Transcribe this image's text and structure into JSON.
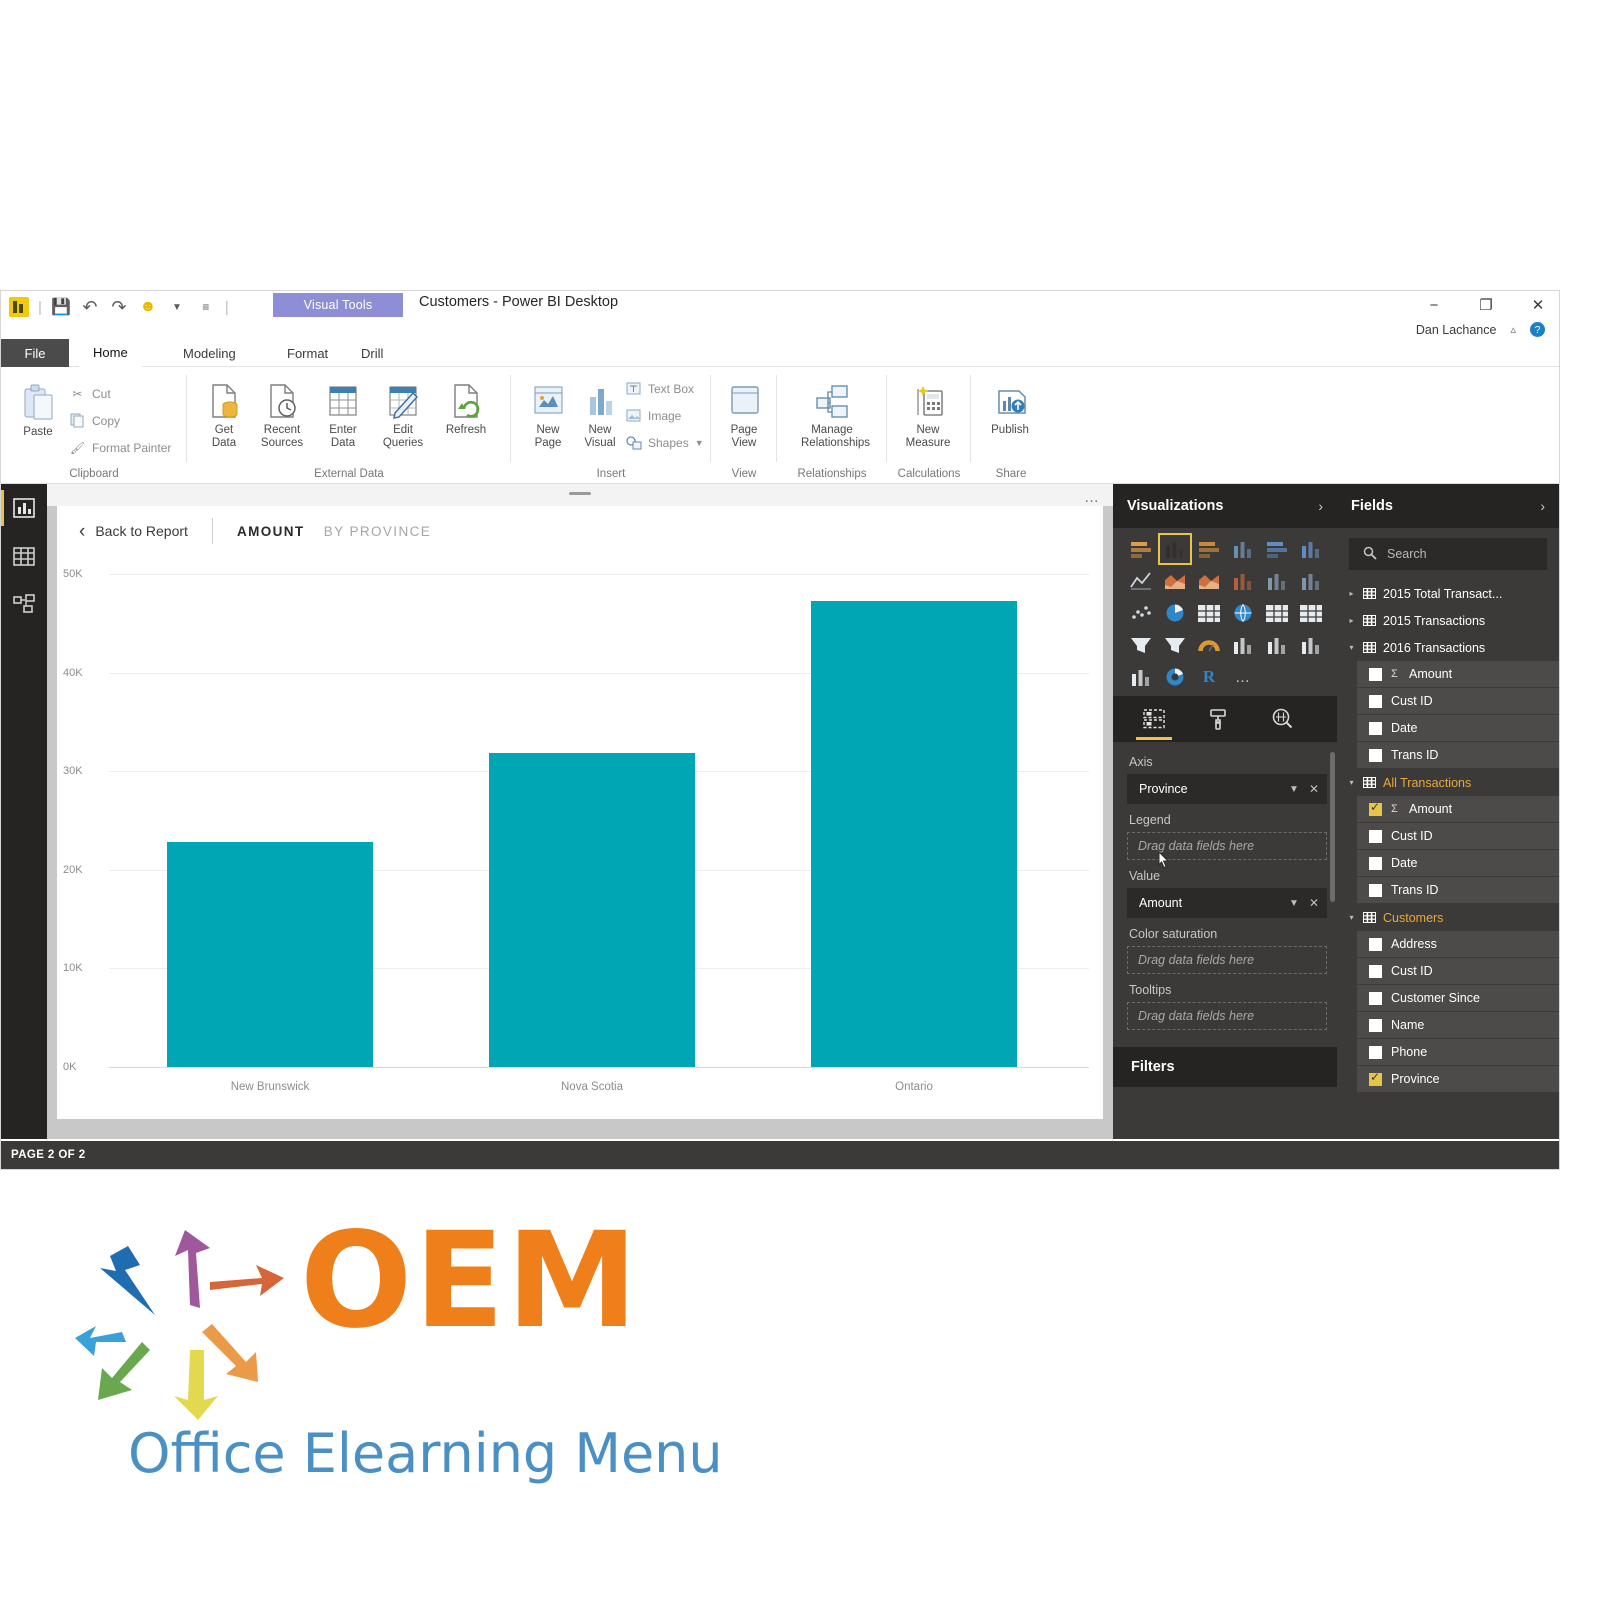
{
  "window": {
    "title": "Customers - Power BI Desktop",
    "context_tab_banner": "Visual Tools",
    "user": "Dan Lachance",
    "minimize_icon": "minimize-icon",
    "restore_icon": "restore-icon",
    "close_icon": "close-icon",
    "collapse_ribbon_icon": "chevron-up-icon",
    "help_icon": "help-icon"
  },
  "quick_access": {
    "app_icon": "power-bi-logo",
    "items": [
      "save-icon",
      "undo-icon",
      "redo-icon",
      "smiley-icon",
      "customize-icon"
    ]
  },
  "ribbon_tabs": [
    {
      "label": "File",
      "state": "file"
    },
    {
      "label": "Home",
      "state": "active"
    },
    {
      "label": "Modeling",
      "state": "normal"
    },
    {
      "label": "Format",
      "state": "normal"
    },
    {
      "label": "Drill",
      "state": "normal"
    }
  ],
  "ribbon_groups": [
    {
      "name": "Clipboard",
      "big_buttons": [
        {
          "label": "Paste",
          "icon": "paste-icon"
        }
      ],
      "small_buttons": [
        {
          "label": "Cut",
          "icon": "scissors-icon"
        },
        {
          "label": "Copy",
          "icon": "copy-icon"
        },
        {
          "label": "Format Painter",
          "icon": "format-painter-icon"
        }
      ]
    },
    {
      "name": "External Data",
      "big_buttons": [
        {
          "label": "Get\nData",
          "icon": "get-data-icon",
          "dropdown": true
        },
        {
          "label": "Recent\nSources",
          "icon": "recent-sources-icon",
          "dropdown": true
        },
        {
          "label": "Enter\nData",
          "icon": "enter-data-icon",
          "dropdown": false
        },
        {
          "label": "Edit\nQueries",
          "icon": "edit-queries-icon",
          "dropdown": true
        },
        {
          "label": "Refresh",
          "icon": "refresh-icon",
          "dropdown": false
        }
      ],
      "small_buttons": []
    },
    {
      "name": "Insert",
      "big_buttons": [
        {
          "label": "New\nPage",
          "icon": "new-page-icon",
          "dropdown": true
        },
        {
          "label": "New\nVisual",
          "icon": "new-visual-icon",
          "dropdown": false
        }
      ],
      "small_buttons": [
        {
          "label": "Text Box",
          "icon": "text-box-icon"
        },
        {
          "label": "Image",
          "icon": "image-icon"
        },
        {
          "label": "Shapes",
          "icon": "shapes-icon"
        }
      ]
    },
    {
      "name": "View",
      "big_buttons": [
        {
          "label": "Page\nView",
          "icon": "page-view-icon",
          "dropdown": true
        }
      ],
      "small_buttons": []
    },
    {
      "name": "Relationships",
      "big_buttons": [
        {
          "label": "Manage\nRelationships",
          "icon": "manage-relationships-icon",
          "dropdown": false
        }
      ],
      "small_buttons": []
    },
    {
      "name": "Calculations",
      "big_buttons": [
        {
          "label": "New\nMeasure",
          "icon": "new-measure-icon",
          "dropdown": true
        }
      ],
      "small_buttons": []
    },
    {
      "name": "Share",
      "big_buttons": [
        {
          "label": "Publish",
          "icon": "publish-icon",
          "dropdown": false
        }
      ],
      "small_buttons": []
    }
  ],
  "left_rail": [
    {
      "name": "report-view",
      "icon": "bar-chart-icon",
      "selected": true
    },
    {
      "name": "data-view",
      "icon": "table-icon",
      "selected": false
    },
    {
      "name": "model-view",
      "icon": "relationships-icon",
      "selected": false
    }
  ],
  "visual_header": {
    "back_label": "Back to Report",
    "back_icon": "chevron-left-icon",
    "title_bold": "AMOUNT",
    "title_light": "BY PROVINCE",
    "more_options_icon": "ellipsis-icon"
  },
  "chart_data": {
    "type": "bar",
    "title": "AMOUNT BY PROVINCE",
    "categories": [
      "New Brunswick",
      "Nova Scotia",
      "Ontario"
    ],
    "values": [
      22800,
      31800,
      47300
    ],
    "series": [
      {
        "name": "Amount",
        "values": [
          22800,
          31800,
          47300
        ]
      }
    ],
    "xlabel": "",
    "ylabel": "",
    "ylim": [
      0,
      50000
    ],
    "ytick_labels": [
      "0K",
      "10K",
      "20K",
      "30K",
      "40K",
      "50K"
    ],
    "ytick_values": [
      0,
      10000,
      20000,
      30000,
      40000,
      50000
    ],
    "grid": true,
    "legend": "none",
    "bar_color": "#00a6b4"
  },
  "visualizations_pane": {
    "header": "Visualizations",
    "expand_icon": "chevron-right-icon",
    "gallery": [
      {
        "name": "stacked-bar-chart-icon",
        "selected": false
      },
      {
        "name": "stacked-column-chart-icon",
        "selected": true
      },
      {
        "name": "clustered-bar-chart-icon",
        "selected": false
      },
      {
        "name": "clustered-column-chart-icon",
        "selected": false
      },
      {
        "name": "hundred-percent-stacked-bar-chart-icon",
        "selected": false
      },
      {
        "name": "hundred-percent-stacked-column-chart-icon",
        "selected": false
      },
      {
        "name": "line-chart-icon",
        "selected": false
      },
      {
        "name": "area-chart-icon",
        "selected": false
      },
      {
        "name": "stacked-area-chart-icon",
        "selected": false
      },
      {
        "name": "line-stacked-column-chart-icon",
        "selected": false
      },
      {
        "name": "line-clustered-column-chart-icon",
        "selected": false
      },
      {
        "name": "ribbon-chart-icon",
        "selected": false
      },
      {
        "name": "scatter-chart-icon",
        "selected": false
      },
      {
        "name": "pie-chart-icon",
        "selected": false
      },
      {
        "name": "treemap-icon",
        "selected": false
      },
      {
        "name": "map-icon",
        "selected": false
      },
      {
        "name": "filled-map-icon",
        "selected": false
      },
      {
        "name": "matrix-icon",
        "selected": false
      },
      {
        "name": "funnel-icon",
        "selected": false
      },
      {
        "name": "funnel-chart-icon",
        "selected": false
      },
      {
        "name": "gauge-icon",
        "selected": false
      },
      {
        "name": "card-icon",
        "selected": false
      },
      {
        "name": "multi-row-card-icon",
        "selected": false
      },
      {
        "name": "kpi-icon",
        "selected": false
      },
      {
        "name": "slicer-icon",
        "selected": false
      },
      {
        "name": "donut-chart-icon",
        "selected": false
      },
      {
        "name": "r-script-visual-icon",
        "selected": false
      },
      {
        "name": "more-visuals-icon",
        "selected": false
      }
    ],
    "tabs": [
      {
        "name": "fields-tab",
        "icon": "fields-well-icon",
        "selected": true
      },
      {
        "name": "format-tab",
        "icon": "paint-roller-icon",
        "selected": false
      },
      {
        "name": "analytics-tab",
        "icon": "magnifier-icon",
        "selected": false
      }
    ],
    "wells": [
      {
        "label": "Axis",
        "value": "Province",
        "placeholder": null
      },
      {
        "label": "Legend",
        "value": null,
        "placeholder": "Drag data fields here"
      },
      {
        "label": "Value",
        "value": "Amount",
        "placeholder": null
      },
      {
        "label": "Color saturation",
        "value": null,
        "placeholder": "Drag data fields here"
      },
      {
        "label": "Tooltips",
        "value": null,
        "placeholder": "Drag data fields here"
      }
    ],
    "filters_header": "Filters",
    "dropdown_icon": "chevron-down-icon",
    "remove_icon": "close-icon"
  },
  "fields_pane": {
    "header": "Fields",
    "expand_icon": "chevron-right-icon",
    "search_placeholder": "Search",
    "search_icon": "search-icon",
    "tables": [
      {
        "name": "2015 Total Transact...",
        "expanded": false,
        "highlight": false,
        "fields": []
      },
      {
        "name": "2015 Transactions",
        "expanded": false,
        "highlight": false,
        "fields": []
      },
      {
        "name": "2016 Transactions",
        "expanded": true,
        "highlight": false,
        "fields": [
          {
            "label": "Amount",
            "checked": false,
            "aggregate": true
          },
          {
            "label": "Cust ID",
            "checked": false,
            "aggregate": false
          },
          {
            "label": "Date",
            "checked": false,
            "aggregate": false
          },
          {
            "label": "Trans ID",
            "checked": false,
            "aggregate": false
          }
        ]
      },
      {
        "name": "All Transactions",
        "expanded": true,
        "highlight": true,
        "fields": [
          {
            "label": "Amount",
            "checked": true,
            "aggregate": true
          },
          {
            "label": "Cust ID",
            "checked": false,
            "aggregate": false
          },
          {
            "label": "Date",
            "checked": false,
            "aggregate": false
          },
          {
            "label": "Trans ID",
            "checked": false,
            "aggregate": false
          }
        ]
      },
      {
        "name": "Customers",
        "expanded": true,
        "highlight": true,
        "fields": [
          {
            "label": "Address",
            "checked": false,
            "aggregate": false
          },
          {
            "label": "Cust ID",
            "checked": false,
            "aggregate": false
          },
          {
            "label": "Customer Since",
            "checked": false,
            "aggregate": false
          },
          {
            "label": "Name",
            "checked": false,
            "aggregate": false
          },
          {
            "label": "Phone",
            "checked": false,
            "aggregate": false
          },
          {
            "label": "Province",
            "checked": true,
            "aggregate": false
          }
        ]
      }
    ]
  },
  "status_bar": {
    "page_indicator": "PAGE 2 OF 2"
  },
  "branding": {
    "logo_text": "OEM",
    "tagline": "Office Elearning Menu"
  },
  "colors": {
    "accent_teal": "#00a6b4",
    "accent_gold": "#e8c547",
    "pane_bg": "#3b3a39",
    "pane_header_bg": "#252423",
    "brand_orange": "#ef7f1a",
    "brand_blue": "#4a90c4"
  }
}
